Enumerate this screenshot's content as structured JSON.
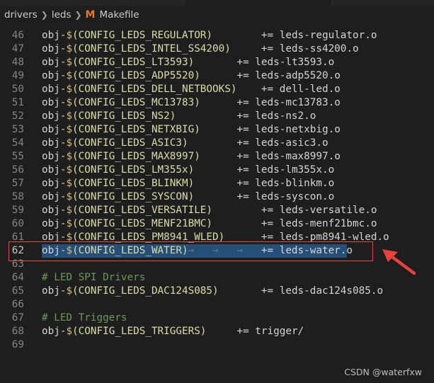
{
  "breadcrumb": {
    "items": [
      "drivers",
      "leds"
    ],
    "file_icon": "M",
    "file_name": "Makefile"
  },
  "editor": {
    "lines": [
      {
        "num": "46",
        "obj": "obj-",
        "dollar": "$",
        "var": "(CONFIG_LEDS_REGULATOR)",
        "sp": "        ",
        "op": "+=",
        "target": " leds-regulator.o"
      },
      {
        "num": "47",
        "obj": "obj-",
        "dollar": "$",
        "var": "(CONFIG_LEDS_INTEL_SS4200)",
        "sp": "     ",
        "op": "+=",
        "target": " leds-ss4200.o"
      },
      {
        "num": "48",
        "obj": "obj-",
        "dollar": "$",
        "var": "(CONFIG_LEDS_LT3593)",
        "sp": "       ",
        "op": "+=",
        "target": " leds-lt3593.o"
      },
      {
        "num": "49",
        "obj": "obj-",
        "dollar": "$",
        "var": "(CONFIG_LEDS_ADP5520)",
        "sp": "      ",
        "op": "+=",
        "target": " leds-adp5520.o"
      },
      {
        "num": "50",
        "obj": "obj-",
        "dollar": "$",
        "var": "(CONFIG_LEDS_DELL_NETBOOKS)",
        "sp": "    ",
        "op": "+=",
        "target": " dell-led.o"
      },
      {
        "num": "51",
        "obj": "obj-",
        "dollar": "$",
        "var": "(CONFIG_LEDS_MC13783)",
        "sp": "      ",
        "op": "+=",
        "target": " leds-mc13783.o"
      },
      {
        "num": "52",
        "obj": "obj-",
        "dollar": "$",
        "var": "(CONFIG_LEDS_NS2)",
        "sp": "          ",
        "op": "+=",
        "target": " leds-ns2.o"
      },
      {
        "num": "53",
        "obj": "obj-",
        "dollar": "$",
        "var": "(CONFIG_LEDS_NETXBIG)",
        "sp": "      ",
        "op": "+=",
        "target": " leds-netxbig.o"
      },
      {
        "num": "54",
        "obj": "obj-",
        "dollar": "$",
        "var": "(CONFIG_LEDS_ASIC3)",
        "sp": "        ",
        "op": "+=",
        "target": " leds-asic3.o"
      },
      {
        "num": "55",
        "obj": "obj-",
        "dollar": "$",
        "var": "(CONFIG_LEDS_MAX8997)",
        "sp": "      ",
        "op": "+=",
        "target": " leds-max8997.o"
      },
      {
        "num": "56",
        "obj": "obj-",
        "dollar": "$",
        "var": "(CONFIG_LEDS_LM355x)",
        "sp": "       ",
        "op": "+=",
        "target": " leds-lm355x.o"
      },
      {
        "num": "57",
        "obj": "obj-",
        "dollar": "$",
        "var": "(CONFIG_LEDS_BLINKM)",
        "sp": "       ",
        "op": "+=",
        "target": " leds-blinkm.o"
      },
      {
        "num": "58",
        "obj": "obj-",
        "dollar": "$",
        "var": "(CONFIG_LEDS_SYSCON)",
        "sp": "       ",
        "op": "+=",
        "target": " leds-syscon.o"
      },
      {
        "num": "59",
        "obj": "obj-",
        "dollar": "$",
        "var": "(CONFIG_LEDS_VERSATILE)",
        "sp": "        ",
        "op": "+=",
        "target": " leds-versatile.o"
      },
      {
        "num": "60",
        "obj": "obj-",
        "dollar": "$",
        "var": "(CONFIG_LEDS_MENF21BMC)",
        "sp": "        ",
        "op": "+=",
        "target": " leds-menf21bmc.o"
      },
      {
        "num": "61",
        "obj": "obj-",
        "dollar": "$",
        "var": "(CONFIG_LEDS_PM8941_WLED)",
        "sp": "      ",
        "op": "+=",
        "target": " leds-pm8941-wled.o"
      },
      {
        "num": "62",
        "obj": "obj-",
        "dollar": "$",
        "var": "(CONFIG_LEDS_WATER)",
        "sp": "",
        "tabs": "→   →   →   ",
        "op": "+=",
        "target": " leds-water.o",
        "current": true
      },
      {
        "num": "63"
      },
      {
        "num": "64",
        "comment": "# LED SPI Drivers"
      },
      {
        "num": "65",
        "obj": "obj-",
        "dollar": "$",
        "var": "(CONFIG_LEDS_DAC124S085)",
        "sp": "       ",
        "op": "+=",
        "target": " leds-dac124s085.o"
      },
      {
        "num": "66"
      },
      {
        "num": "67",
        "comment": "# LED Triggers"
      },
      {
        "num": "68",
        "obj": "obj-",
        "dollar": "$",
        "var": "(CONFIG_LEDS_TRIGGERS)",
        "sp": "     ",
        "op": "+=",
        "target": " trigger/"
      },
      {
        "num": "69"
      }
    ]
  },
  "watermark": "CSDN @waterfxw",
  "colors": {
    "background": "#1e1e1e",
    "highlight_box": "#e04a4a",
    "selection": "#264f78",
    "variable": "#dcdcaa",
    "comment": "#6a9955",
    "arrow": "#e8413c"
  }
}
